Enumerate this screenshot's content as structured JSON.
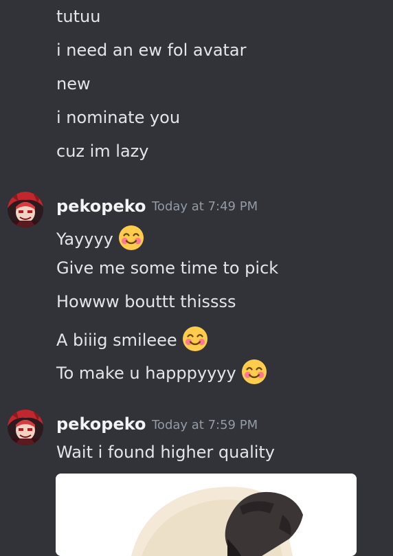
{
  "group0": {
    "lines": [
      "tutuu",
      "i need an ew fol avatar",
      "new",
      "i nominate you",
      "cuz im lazy"
    ]
  },
  "group1": {
    "author": "pekopeko",
    "timestamp": "Today at 7:49 PM",
    "lines": [
      "Yayyyy",
      "Give me some time to pick",
      "Howww bouttt thissss",
      "A biiig smileee",
      "To make u happpyyyy"
    ],
    "line_emojis": [
      "smiling-face-with-blush",
      "",
      "",
      "smiling-face-with-blush",
      "smiling-face-with-blush"
    ]
  },
  "group2": {
    "author": "pekopeko",
    "timestamp": "Today at 7:59 PM",
    "lines": [
      "Wait i found higher quality"
    ],
    "attachment": "anime-character-image"
  },
  "colors": {
    "background": "#313338",
    "text": "#e3e5e8",
    "username": "#f2f3f5",
    "timestamp": "#949ba4",
    "emoji_face": "#ffcc4d"
  }
}
